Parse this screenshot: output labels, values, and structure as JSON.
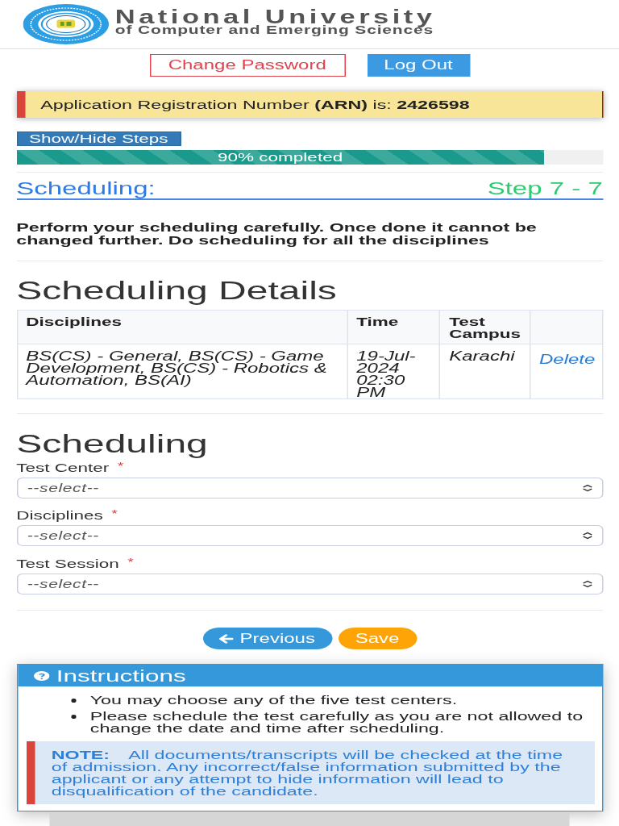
{
  "header": {
    "title": "National University",
    "subtitle": "of Computer and Emerging Sciences"
  },
  "account_buttons": [
    {
      "label": "Change Password",
      "kind": "outline"
    },
    {
      "label": "Log Out",
      "kind": "solid"
    }
  ],
  "arn_alert": {
    "text": "Application Registration Number **(ARN)** is: **2426598**"
  },
  "steps_toggle": {
    "label": "Show/Hide Steps"
  },
  "progress": {
    "level": 0.9,
    "label": "90% completed"
  },
  "step_header": {
    "title": "Scheduling:",
    "step": "Step 7 - 7"
  },
  "notice": "Perform your scheduling carefully. Once done it cannot be changed further. Do scheduling for all the disciplines",
  "scheduling_details": {
    "title": "Scheduling Details",
    "table": {
      "columns": [
        "Disciplines",
        "Time",
        "Test Campus"
      ],
      "rows": [
        {
          "cells": [
            "BS(CS) - General, BS(CS) - Game Development, BS(CS) - Robotics & Automation, BS(AI)",
            "19-Jul-2024 02:30 PM",
            "Karachi"
          ],
          "action": "Delete"
        }
      ]
    }
  },
  "scheduling_form": {
    "title": "Scheduling",
    "fields": [
      {
        "label": "Test Center",
        "required_mark": "*",
        "value": "--select--"
      },
      {
        "label": "Disciplines",
        "required_mark": "*",
        "value": "--select--"
      },
      {
        "label": "Test Session",
        "required_mark": "*",
        "value": "--select--"
      }
    ]
  },
  "nav_buttons": [
    {
      "label": "Previous",
      "kind": "back"
    },
    {
      "label": "Save",
      "kind": "save"
    }
  ],
  "instructions": {
    "title": "Instructions",
    "items": [
      "You may choose any of the five test centers.",
      "Please schedule the test carefully as you are not allowed to change the date and time after scheduling."
    ],
    "note": "**NOTE:** All documents/transcripts will be checked at the time of admission. Any incorrect/false information submitted by the applicant or any attempt to hide information will lead to disqualification of the candidate."
  }
}
